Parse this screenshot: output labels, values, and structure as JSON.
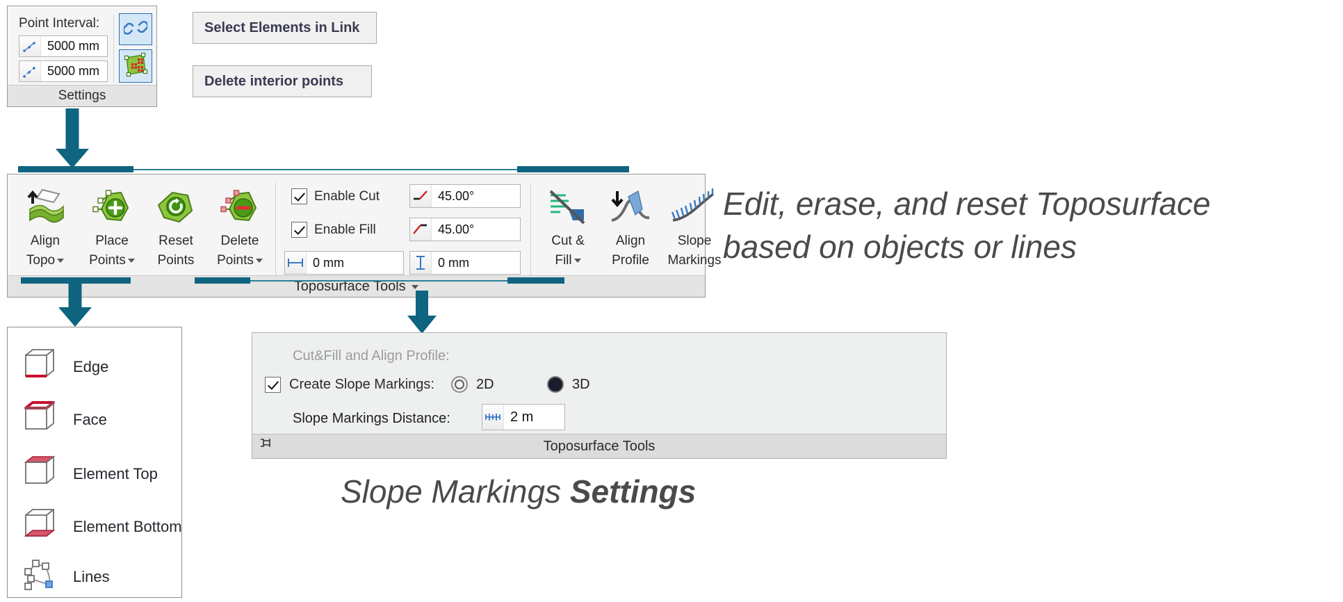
{
  "settings_panel": {
    "caption": "Settings",
    "point_interval_label": "Point Interval:",
    "fields": [
      {
        "icon": "point-interval-solid-icon",
        "value": "5000 mm"
      },
      {
        "icon": "point-interval-dashed-icon",
        "value": "5000 mm"
      }
    ],
    "toggles": [
      {
        "icon": "link-icon",
        "name": "link-toggle",
        "state": "on"
      },
      {
        "icon": "interior-points-icon",
        "name": "interior-points-toggle",
        "state": "on"
      }
    ]
  },
  "action_buttons": {
    "select_elements": "Select Elements in Link",
    "delete_interior": "Delete interior points"
  },
  "topo_ribbon": {
    "caption": "Toposurface Tools",
    "caption_has_dropdown": true,
    "tools": [
      {
        "name": "align-topo",
        "line1": "Align",
        "line2": "Topo",
        "icon": "align-topo-icon",
        "has_dropdown": true
      },
      {
        "name": "place-points",
        "line1": "Place",
        "line2": "Points",
        "icon": "place-points-icon",
        "has_dropdown": true
      },
      {
        "name": "reset-points",
        "line1": "Reset",
        "line2": "Points",
        "icon": "reset-points-icon",
        "has_dropdown": false
      },
      {
        "name": "delete-points",
        "line1": "Delete",
        "line2": "Points",
        "icon": "delete-points-icon",
        "has_dropdown": true
      }
    ],
    "checkboxes": [
      {
        "name": "enable-cut",
        "label": "Enable Cut",
        "checked": true
      },
      {
        "name": "enable-fill",
        "label": "Enable Fill",
        "checked": true
      }
    ],
    "angle_fields": [
      {
        "name": "cut-angle-field",
        "icon": "cut-slope-icon",
        "value": "45.00°"
      },
      {
        "name": "fill-angle-field",
        "icon": "fill-slope-icon",
        "value": "45.00°"
      }
    ],
    "offset_fields": [
      {
        "name": "horizontal-offset-field",
        "icon": "horizontal-offset-icon",
        "value": "0 mm"
      },
      {
        "name": "vertical-offset-field",
        "icon": "vertical-offset-icon",
        "value": "0 mm"
      }
    ],
    "right_tools": [
      {
        "name": "cut-and-fill",
        "line1": "Cut &",
        "line2": "Fill",
        "icon": "cut-and-fill-icon",
        "has_dropdown": true
      },
      {
        "name": "align-profile",
        "line1": "Align",
        "line2": "Profile",
        "icon": "align-profile-icon",
        "has_dropdown": false
      },
      {
        "name": "slope-markings",
        "line1": "Slope",
        "line2": "Markings",
        "icon": "slope-markings-icon",
        "has_dropdown": false
      }
    ]
  },
  "options_panel": {
    "items": [
      {
        "name": "edge",
        "label": "Edge",
        "icon": "cube-edge-icon"
      },
      {
        "name": "face",
        "label": "Face",
        "icon": "cube-face-icon"
      },
      {
        "name": "element-top",
        "label": "Element Top",
        "icon": "cube-top-icon"
      },
      {
        "name": "element-bottom",
        "label": "Element Bottom",
        "icon": "cube-bottom-icon"
      },
      {
        "name": "lines",
        "label": "Lines",
        "icon": "lines-icon"
      }
    ]
  },
  "slope_dialog": {
    "section_label": "Cut&Fill and Align Profile:",
    "create_slope_markings": {
      "label": "Create Slope Markings:",
      "checked": true
    },
    "mode_options": [
      {
        "name": "mode-2d",
        "label": "2D",
        "selected": false
      },
      {
        "name": "mode-3d",
        "label": "3D",
        "selected": true
      }
    ],
    "distance": {
      "label": "Slope Markings Distance:",
      "icon": "distance-icon",
      "value": "2 m"
    },
    "caption": "Toposurface Tools",
    "pin_icon": "pin-icon"
  },
  "annotations": {
    "right_line1": "Edit, erase, and reset Toposurface",
    "right_line2": "based on objects or lines",
    "bottom_normal": "Slope Markings ",
    "bottom_bold": "Settings"
  },
  "colors": {
    "accent_teal": "#0f6480",
    "toggle_blue": "#2a6fb8",
    "panel_gray": "#f5f5f5",
    "red_accent": "#c8102e",
    "green": "#6aab2b"
  }
}
